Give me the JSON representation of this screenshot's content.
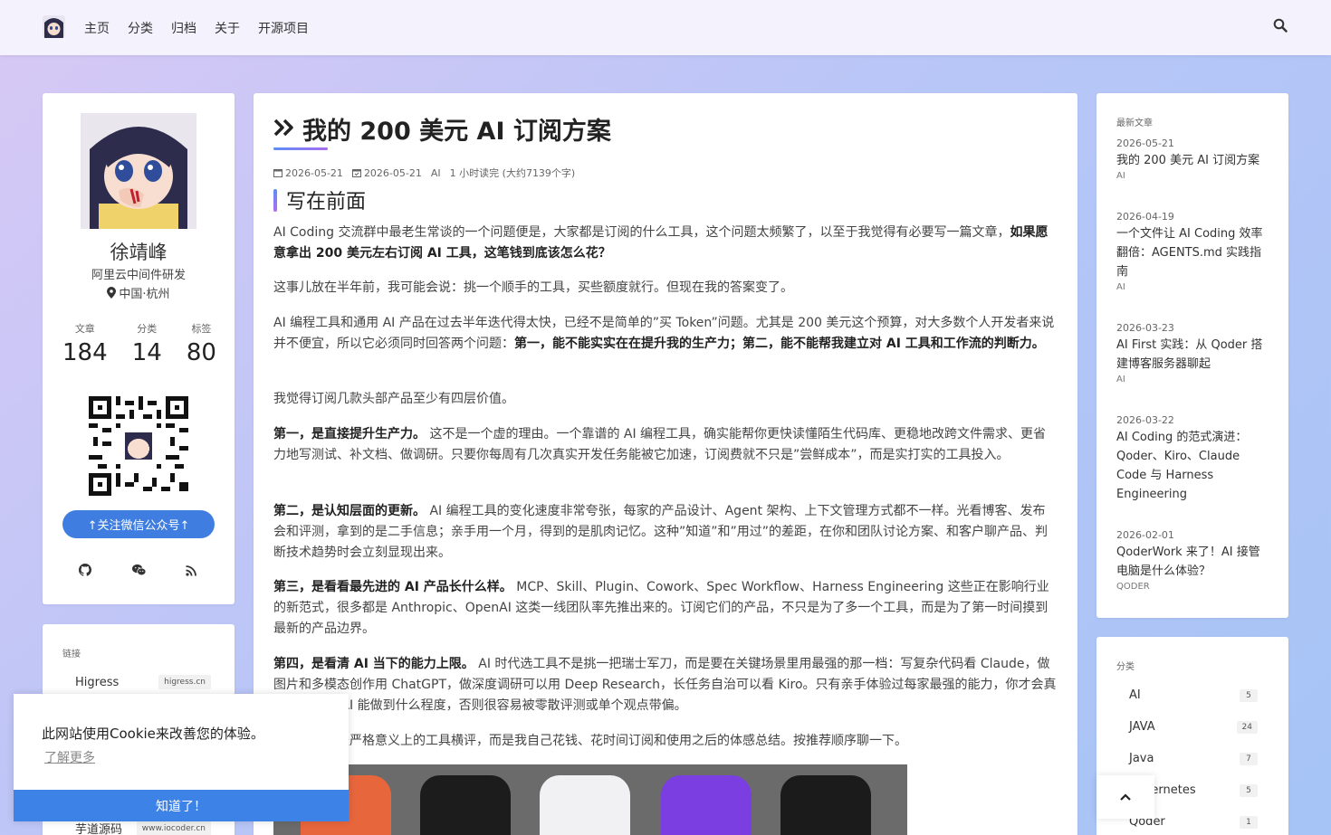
{
  "nav": {
    "items": [
      "主页",
      "分类",
      "归档",
      "关于",
      "开源项目"
    ]
  },
  "profile": {
    "name": "徐靖峰",
    "job": "阿里云中间件研发",
    "location": "中国·杭州",
    "stats": [
      {
        "label": "文章",
        "value": "184"
      },
      {
        "label": "分类",
        "value": "14"
      },
      {
        "label": "标签",
        "value": "80"
      }
    ],
    "follow_label": "↑关注微信公众号↑",
    "social_icons": [
      "github-icon",
      "wechat-icon",
      "rss-icon"
    ]
  },
  "links": {
    "title": "链接",
    "items": [
      {
        "name": "Higress",
        "url": "higress.cn"
      },
      {
        "name": "芋道源码",
        "url": "www.iocoder.cn"
      }
    ]
  },
  "post": {
    "title": "我的 200 美元 AI 订阅方案",
    "created": "2026-05-21",
    "updated": "2026-05-21",
    "category": "AI",
    "reading": "1 小时读完 (大约7139个字)",
    "section_title": "写在前面",
    "paragraphs": [
      {
        "text": "AI Coding 交流群中最老生常谈的一个问题便是，大家都是订阅的什么工具，这个问题太频繁了，以至于我觉得有必要写一篇文章，",
        "bold": "如果愿意拿出 200 美元左右订阅 AI 工具，这笔钱到底该怎么花？",
        "tail": ""
      },
      {
        "text": "这事儿放在半年前，我可能会说：挑一个顺手的工具，买些额度就行。但现在我的答案变了。",
        "bold": "",
        "tail": ""
      },
      {
        "text": "AI 编程工具和通用 AI 产品在过去半年迭代得太快，已经不是简单的”买 Token”问题。尤其是 200 美元这个预算，对大多数个人开发者来说并不便宜，所以它必须同时回答两个问题：",
        "bold": "第一，能不能实实在在提升我的生产力；第二，能不能帮我建立对 AI 工具和工作流的判断力。",
        "tail": ""
      },
      {
        "text": "我觉得订阅几款头部产品至少有四层价值。",
        "bold": "",
        "tail": ""
      },
      {
        "text": "",
        "bold": "第一，是直接提升生产力。",
        "tail": " 这不是一个虚的理由。一个靠谱的 AI 编程工具，确实能帮你更快读懂陌生代码库、更稳地改跨文件需求、更省力地写测试、补文档、做调研。只要你每周有几次真实开发任务能被它加速，订阅费就不只是”尝鲜成本”，而是实打实的工具投入。"
      },
      {
        "text": "",
        "bold": "第二，是认知层面的更新。",
        "tail": " AI 编程工具的变化速度非常夸张，每家的产品设计、Agent 架构、上下文管理方式都不一样。光看博客、发布会和评测，拿到的是二手信息；亲手用一个月，得到的是肌肉记忆。这种”知道”和”用过”的差距，在你和团队讨论方案、和客户聊产品、判断技术趋势时会立刻显现出来。"
      },
      {
        "text": "",
        "bold": "第三，是看看最先进的 AI 产品长什么样。",
        "tail": " MCP、Skill、Plugin、Cowork、Spec Workflow、Harness Engineering 这些正在影响行业的新范式，很多都是 Anthropic、OpenAI 这类一线团队率先推出来的。订阅它们的产品，不只是为了多一个工具，而是为了第一时间摸到最新的产品边界。"
      },
      {
        "text": "",
        "bold": "第四，是看清 AI 当下的能力上限。",
        "tail": " AI 时代选工具不是挑一把瑞士军刀，而是要在关键场景里用最强的那一档：写复杂代码看 Claude，做图片和多模态创作用 ChatGPT，做深度调研可以用 Deep Research，长任务自治可以看 Kiro。只有亲手体验过每家最强的能力，你才会真正知道当下 AI 能做到什么程度，否则很容易被零散评测或单个观点带偏。"
      },
      {
        "text": "下面这篇不是严格意义上的工具横评，而是我自己花钱、花时间订阅和使用之后的体感总结。按推荐顺序聊一下。",
        "bold": "",
        "tail": ""
      }
    ]
  },
  "recent": {
    "title": "最新文章",
    "items": [
      {
        "date": "2026-05-21",
        "title": "我的 200 美元 AI 订阅方案",
        "category": "AI"
      },
      {
        "date": "2026-04-19",
        "title": "一个文件让 AI Coding 效率翻倍：AGENTS.md 实践指南",
        "category": "AI"
      },
      {
        "date": "2026-03-23",
        "title": "AI First 实践：从 Qoder 搭建博客服务器聊起",
        "category": "AI"
      },
      {
        "date": "2026-03-22",
        "title": "AI Coding 的范式演进：Qoder、Kiro、Claude Code 与 Harness Engineering",
        "category": ""
      },
      {
        "date": "2026-02-01",
        "title": "QoderWork 来了！AI 接管电脑是什么体验？",
        "category": "QODER"
      }
    ]
  },
  "categories": {
    "title": "分类",
    "items": [
      {
        "name": "AI",
        "count": "5"
      },
      {
        "name": "JAVA",
        "count": "24"
      },
      {
        "name": "Java",
        "count": "7"
      },
      {
        "name": "Kubernetes",
        "count": "5"
      },
      {
        "name": "Qoder",
        "count": "1"
      }
    ]
  },
  "cookie": {
    "message": "此网站使用Cookie来改善您的体验。",
    "learn_more": "了解更多",
    "accept": "知道了！"
  },
  "colors": {
    "accent": "#3f7ee0",
    "navbar_bg": "#f3f2fd"
  }
}
